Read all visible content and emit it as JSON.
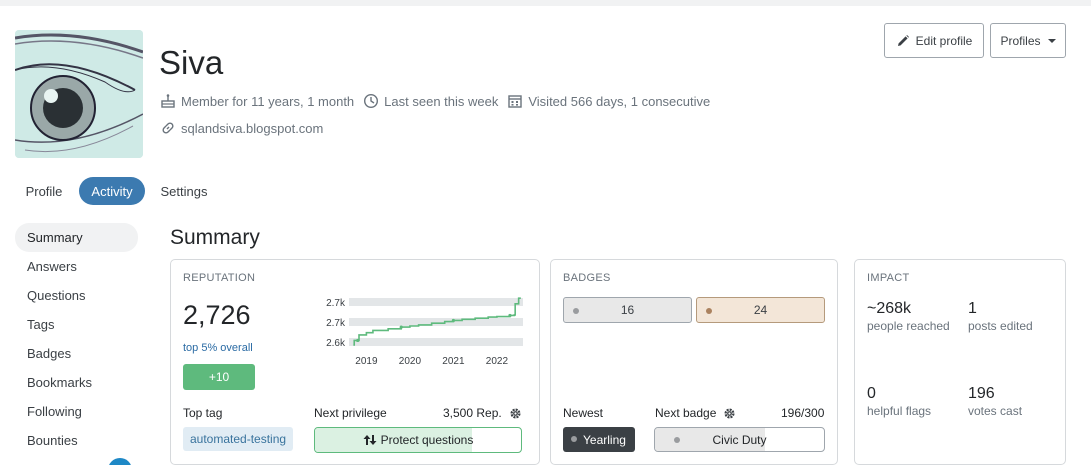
{
  "colors": {
    "accent": "#3c7ab0",
    "green": "#5eba7d",
    "link": "#2b6ba4"
  },
  "user": {
    "name": "Siva",
    "member_for": "Member for 11 years, 1 month",
    "last_seen": "Last seen this week",
    "visited": "Visited 566 days, 1 consecutive",
    "website": "sqlandsiva.blogspot.com"
  },
  "header_buttons": {
    "edit": "Edit profile",
    "profiles": "Profiles"
  },
  "tabs": [
    {
      "label": "Profile",
      "active": false
    },
    {
      "label": "Activity",
      "active": true
    },
    {
      "label": "Settings",
      "active": false
    }
  ],
  "sidebar": {
    "items": [
      {
        "label": "Summary",
        "active": true
      },
      {
        "label": "Answers",
        "active": false
      },
      {
        "label": "Questions",
        "active": false
      },
      {
        "label": "Tags",
        "active": false
      },
      {
        "label": "Badges",
        "active": false
      },
      {
        "label": "Bookmarks",
        "active": false
      },
      {
        "label": "Following",
        "active": false
      },
      {
        "label": "Bounties",
        "active": false
      }
    ]
  },
  "section_title": "Summary",
  "reputation": {
    "label": "REPUTATION",
    "value": "2,726",
    "rank": "top 5% overall",
    "gain": "+10",
    "top_tag_label": "Top tag",
    "top_tag": "automated-testing",
    "next_privilege_label": "Next privilege",
    "next_privilege_rep": "3,500 Rep.",
    "next_privilege_name": "Protect questions",
    "next_privilege_progress": 0.76
  },
  "chart_data": {
    "type": "line",
    "title": "",
    "xlabel": "",
    "ylabel": "",
    "y_tick_labels": [
      "2.7k",
      "2.7k",
      "2.6k"
    ],
    "x_tick_labels": [
      "2019",
      "2020",
      "2021",
      "2022"
    ],
    "xlim": [
      2018.6,
      2022.6
    ],
    "ylim": [
      2640,
      2730
    ],
    "grid": true,
    "series": [
      {
        "color": "#5eba7d",
        "x": [
          2018.7,
          2018.72,
          2018.8,
          2018.83,
          2019.0,
          2019.15,
          2019.5,
          2019.8,
          2020.0,
          2020.2,
          2020.5,
          2020.8,
          2021.0,
          2021.2,
          2021.5,
          2021.8,
          2022.0,
          2022.3,
          2022.4,
          2022.42,
          2022.5,
          2022.55
        ],
        "y": [
          2642,
          2650,
          2650,
          2660,
          2664,
          2668,
          2671,
          2674,
          2676,
          2678,
          2681,
          2684,
          2686,
          2688,
          2690,
          2692,
          2693,
          2695,
          2696,
          2716,
          2726,
          2726
        ]
      }
    ]
  },
  "badges": {
    "label": "BADGES",
    "silver": "16",
    "bronze": "24",
    "newest_label": "Newest",
    "newest": "Yearling",
    "next_badge_label": "Next badge",
    "next_badge_progress_text": "196/300",
    "next_badge_name": "Civic Duty",
    "next_badge_progress": 0.653
  },
  "impact": {
    "label": "IMPACT",
    "people_reached": "~268k",
    "people_reached_label": "people reached",
    "posts_edited": "1",
    "posts_edited_label": "posts edited",
    "helpful_flags": "0",
    "helpful_flags_label": "helpful flags",
    "votes_cast": "196",
    "votes_cast_label": "votes cast"
  }
}
